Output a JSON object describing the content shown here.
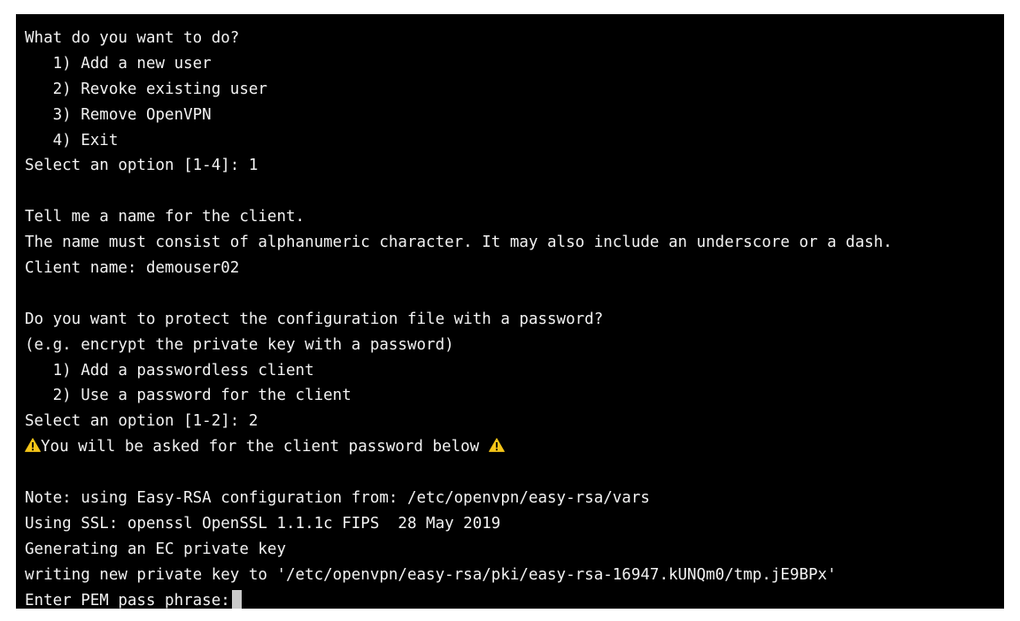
{
  "terminal": {
    "lines": [
      "What do you want to do?",
      "   1) Add a new user",
      "   2) Revoke existing user",
      "   3) Remove OpenVPN",
      "   4) Exit",
      "Select an option [1-4]: 1",
      "",
      "Tell me a name for the client.",
      "The name must consist of alphanumeric character. It may also include an underscore or a dash.",
      "Client name: demouser02",
      "",
      "Do you want to protect the configuration file with a password?",
      "(e.g. encrypt the private key with a password)",
      "   1) Add a passwordless client",
      "   2) Use a password for the client",
      "Select an option [1-2]: 2"
    ],
    "warning_text": "You will be asked for the client password below ",
    "warning_icon": "warning-icon",
    "warning_color": "#f5c518",
    "lines_after": [
      "",
      "Note: using Easy-RSA configuration from: /etc/openvpn/easy-rsa/vars",
      "Using SSL: openssl OpenSSL 1.1.1c FIPS  28 May 2019",
      "Generating an EC private key",
      "writing new private key to '/etc/openvpn/easy-rsa/pki/easy-rsa-16947.kUNQm0/tmp.jE9BPx'"
    ],
    "prompt": "Enter PEM pass phrase:"
  }
}
